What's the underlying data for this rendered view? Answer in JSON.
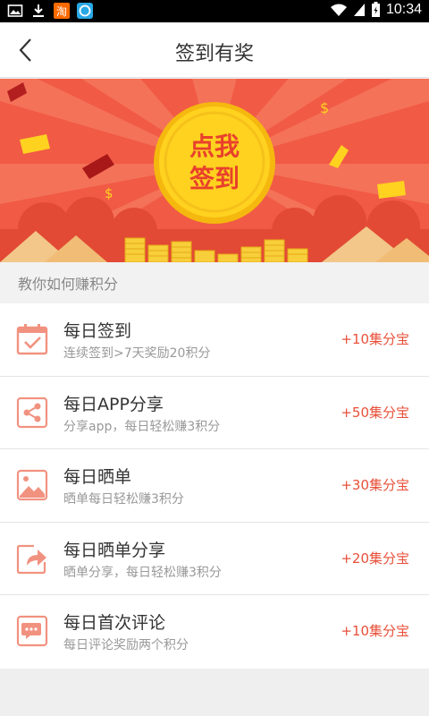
{
  "status_bar": {
    "time": "10:34",
    "left_icons": [
      "image-icon",
      "download-icon",
      "taobao-app-icon",
      "browser-app-icon"
    ],
    "right_icons": [
      "wifi-icon",
      "signal-icon",
      "battery-icon"
    ]
  },
  "header": {
    "title": "签到有奖",
    "back_icon": "chevron-left-icon"
  },
  "banner": {
    "coin_line1": "点我",
    "coin_line2": "签到"
  },
  "section": {
    "title": "教你如何赚积分"
  },
  "tasks": [
    {
      "icon": "calendar-check-icon",
      "title": "每日签到",
      "subtitle": "连续签到>7天奖励20积分",
      "reward": "+10集分宝"
    },
    {
      "icon": "share-icon",
      "title": "每日APP分享",
      "subtitle": "分享app，每日轻松赚3积分",
      "reward": "+50集分宝"
    },
    {
      "icon": "image-icon",
      "title": "每日晒单",
      "subtitle": "晒单每日轻松赚3积分",
      "reward": "+30集分宝"
    },
    {
      "icon": "forward-arrow-icon",
      "title": "每日晒单分享",
      "subtitle": "晒单分享，每日轻松赚3积分",
      "reward": "+20集分宝"
    },
    {
      "icon": "chat-bubble-icon",
      "title": "每日首次评论",
      "subtitle": "每日评论奖励两个积分",
      "reward": "+10集分宝"
    }
  ],
  "colors": {
    "accent_red": "#e8503a",
    "icon_red": "#f19280",
    "banner_bg": "#f15a45",
    "coin_gold": "#ffd21f"
  }
}
